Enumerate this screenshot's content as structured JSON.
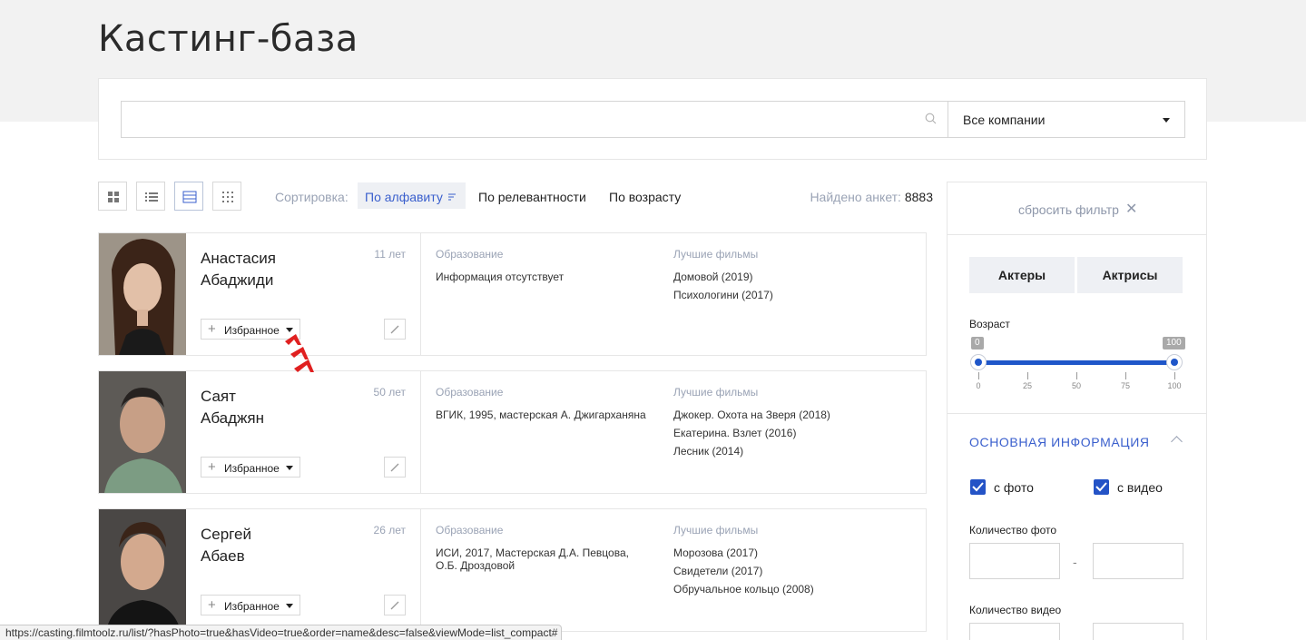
{
  "page": {
    "title": "Кастинг-база"
  },
  "search": {
    "value": "",
    "placeholder": "",
    "company_select": "Все компании"
  },
  "toolbar": {
    "sort_label": "Сортировка:",
    "sort_options": [
      "По алфавиту",
      "По релевантности",
      "По возрасту"
    ],
    "active_sort": "По алфавиту",
    "found_label": "Найдено анкет:",
    "found_count": "8883"
  },
  "columns": {
    "education": "Образование",
    "best_films": "Лучшие фильмы"
  },
  "favorite_label": "Избранное",
  "actors": [
    {
      "first_name": "Анастасия",
      "last_name": "Абаджиди",
      "age": "11 лет",
      "education": "Информация отсутствует",
      "films": [
        "Домовой (2019)",
        "Психологини (2017)"
      ]
    },
    {
      "first_name": "Саят",
      "last_name": "Абаджян",
      "age": "50 лет",
      "education": "ВГИК, 1995, мастерская А. Джигарханяна",
      "films": [
        "Джокер. Охота на Зверя (2018)",
        "Екатерина. Взлет (2016)",
        "Лесник (2014)"
      ]
    },
    {
      "first_name": "Сергей",
      "last_name": "Абаев",
      "age": "26 лет",
      "education": "ИСИ, 2017, Мастерская Д.А. Певцова, О.Б. Дроздовой",
      "films": [
        "Морозова (2017)",
        "Свидетели (2017)",
        "Обручальное кольцо (2008)"
      ]
    }
  ],
  "sidebar": {
    "reset_label": "сбросить фильтр",
    "gender_buttons": [
      "Актеры",
      "Актрисы"
    ],
    "age_label": "Возраст",
    "age_min": "0",
    "age_max": "100",
    "age_ticks": [
      "0",
      "25",
      "50",
      "75",
      "100"
    ],
    "section_title": "ОСНОВНАЯ ИНФОРМАЦИЯ",
    "with_photo": "с фото",
    "with_video": "с видео",
    "with_photo_checked": true,
    "with_video_checked": true,
    "photo_count_label": "Количество фото",
    "video_count_label": "Количество видео",
    "range_dash": "-"
  },
  "status_bar": {
    "url": "https://casting.filmtoolz.ru/list/?hasPhoto=true&hasVideo=true&order=name&desc=false&viewMode=list_compact#"
  },
  "colors": {
    "accent": "#3a5fcd",
    "slider": "#1f56c9",
    "checkbox": "#2453c6",
    "muted": "#9aa3b5",
    "cursor": "#e02020"
  }
}
